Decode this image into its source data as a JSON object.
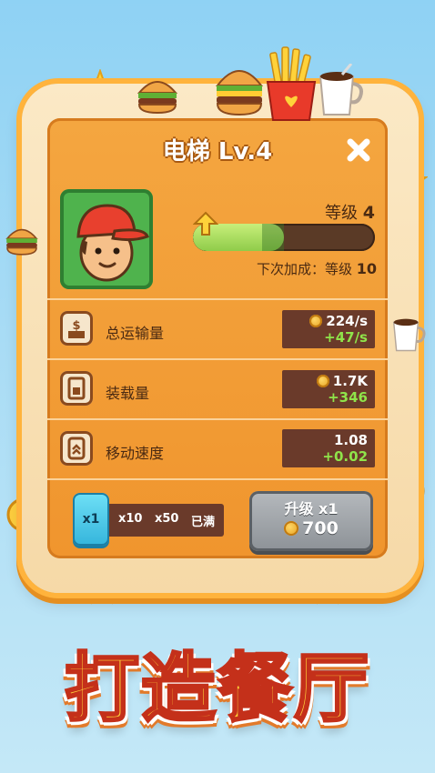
{
  "panel": {
    "title": "电梯 Lv.4",
    "level_label": "等级",
    "level_value": "4",
    "level_progress": 0.5,
    "next_bonus_label": "下次加成：等级",
    "next_bonus_value": "10"
  },
  "stats": [
    {
      "label": "总运输量",
      "value": "224/s",
      "delta": "+47/s",
      "coin": true,
      "icon": "transport-icon"
    },
    {
      "label": "装载量",
      "value": "1.7K",
      "delta": "+346",
      "coin": true,
      "icon": "capacity-icon"
    },
    {
      "label": "移动速度",
      "value": "1.08",
      "delta": "+0.02",
      "coin": false,
      "icon": "speed-icon"
    }
  ],
  "multiplier": {
    "options": [
      "x1",
      "x10",
      "x50",
      "已满"
    ],
    "selected": "x1"
  },
  "upgrade": {
    "label": "升级 x1",
    "cost": "700"
  },
  "banner": "打造餐厅",
  "colors": {
    "panel": "#f0952e",
    "accent": "#ffb33c",
    "bar_fill": "#8fcc4a",
    "delta": "#8fe44a"
  }
}
